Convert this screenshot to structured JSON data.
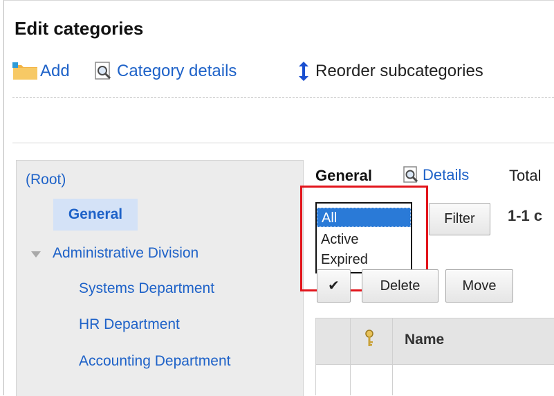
{
  "page": {
    "title": "Edit categories"
  },
  "toolbar": {
    "add_label": "Add",
    "details_label": "Category details",
    "reorder_label": "Reorder subcategories"
  },
  "tree": {
    "root": "(Root)",
    "items": [
      {
        "label": "General",
        "selected": true,
        "level": 1
      },
      {
        "label": "Administrative Division",
        "level": 1,
        "expanded": true
      },
      {
        "label": "Systems Department",
        "level": 2
      },
      {
        "label": "HR Department",
        "level": 2
      },
      {
        "label": "Accounting Department",
        "level": 2
      }
    ]
  },
  "detail": {
    "category": "General",
    "details_link": "Details",
    "total_text": "Total"
  },
  "filter": {
    "options": [
      "All",
      "Active",
      "Expired"
    ],
    "selected": "All",
    "button_label": "Filter",
    "range_text": "1-1 c"
  },
  "actions": {
    "check_glyph": "✔",
    "delete_label": "Delete",
    "move_label": "Move"
  },
  "table": {
    "columns": [
      "",
      "key-icon",
      "Name"
    ],
    "name_header": "Name"
  },
  "colors": {
    "link": "#1e62c8",
    "highlight_box": "#e2141b",
    "selected_option": "#2a7ad7",
    "tree_selected_bg": "#d4e2f7"
  }
}
